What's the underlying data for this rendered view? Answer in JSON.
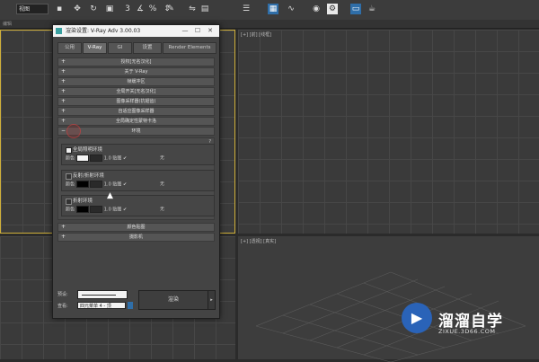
{
  "toolbar": {
    "view_select": "视图",
    "buttons": [
      {
        "icon": "select-icon",
        "glyph": "▪"
      },
      {
        "icon": "move-icon",
        "glyph": "✥"
      },
      {
        "icon": "rotate-icon",
        "glyph": "↻"
      },
      {
        "icon": "scale-icon",
        "glyph": "▣"
      },
      {
        "icon": "snap-3-icon",
        "glyph": "3"
      },
      {
        "icon": "snap-angle-icon",
        "glyph": "∡"
      },
      {
        "icon": "snap-percent-icon",
        "glyph": "%"
      },
      {
        "icon": "spinner-snap-icon",
        "glyph": "⇕"
      },
      {
        "icon": "edit-named-selection-icon",
        "glyph": "✎"
      },
      {
        "icon": "mirror-icon",
        "glyph": "⇋"
      },
      {
        "icon": "align-icon",
        "glyph": "▤"
      },
      {
        "icon": "layer-icon",
        "glyph": "☰"
      },
      {
        "icon": "scene-explorer-icon",
        "glyph": "▦"
      },
      {
        "icon": "curve-editor-icon",
        "glyph": "∿"
      },
      {
        "icon": "material-editor-icon",
        "glyph": "◉"
      },
      {
        "icon": "render-setup-icon",
        "glyph": "⚙"
      },
      {
        "icon": "rendered-frame-icon",
        "glyph": "▭"
      },
      {
        "icon": "render-icon",
        "glyph": "☕"
      }
    ]
  },
  "subbar": {
    "label": "编辑"
  },
  "viewports": {
    "top_left": "",
    "top_right": "[+] [前] [线框]",
    "bottom_left": "",
    "bottom_right": "[+] [透视] [真实]"
  },
  "dialog": {
    "title": "渲染设置: V-Ray Adv 3.00.03",
    "window_buttons": [
      "—",
      "☐",
      "✕"
    ],
    "tabs": [
      "公用",
      "V-Ray",
      "GI",
      "设置",
      "Render Elements"
    ],
    "active_tab": "V-Ray",
    "rollouts_top": [
      "授权[无名汉化]",
      "关于 V-Ray",
      "帧缓冲区",
      "全局开关[无名汉化]",
      "图像采样器(抗锯齿)",
      "自适应图像采样器",
      "全局确定性蒙特卡洛"
    ],
    "environment": {
      "header": "环境",
      "help": "?",
      "groups": [
        {
          "label": "全局照明环境",
          "checked": true,
          "color_label": "颜色",
          "swatch": "#f4f4f4",
          "multiplier": "1.0",
          "map_label": "贴图",
          "map_checked": true,
          "map_value": "无"
        },
        {
          "label": "反射/折射环境",
          "checked": false,
          "color_label": "颜色",
          "swatch": "#000000",
          "multiplier": "1.0",
          "map_label": "贴图",
          "map_checked": true,
          "map_value": "无"
        },
        {
          "label": "折射环境",
          "checked": false,
          "color_label": "颜色",
          "swatch": "#000000",
          "multiplier": "1.0",
          "map_label": "贴图",
          "map_checked": true,
          "map_value": "无"
        }
      ]
    },
    "rollouts_bottom": [
      "颜色贴图",
      "摄影机"
    ],
    "preset_label": "预设:",
    "view_label": "查看:",
    "view_value": "四元菜单 4 - 顶",
    "render_button": "渲染",
    "render_arrow": "▸"
  },
  "watermark": {
    "logo_glyph": "▶",
    "title": "溜溜自学",
    "url": "ZIXUE.3D66.COM"
  }
}
